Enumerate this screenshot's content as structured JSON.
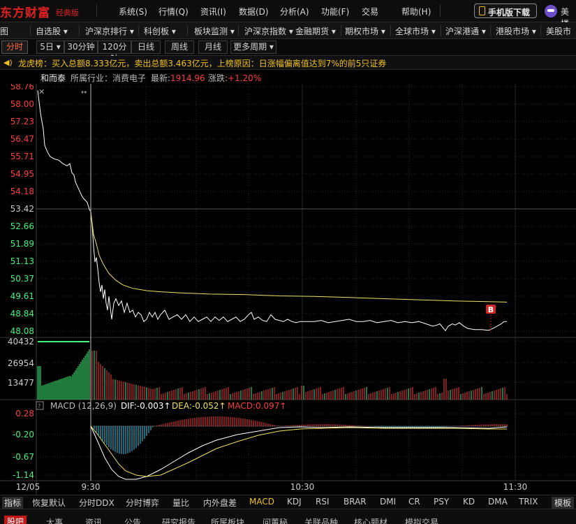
{
  "menubar": {
    "logo": "东方财富",
    "edition": "经典版",
    "items": [
      "系统(S)",
      "行情(Q)",
      "资讯(I)",
      "数据(D)",
      "分析(A)",
      "功能(F)",
      "交易",
      "帮助(H)"
    ],
    "mobile_button": "手机版下载",
    "user": "美楼"
  },
  "marketbar": {
    "items": [
      "自选股 ▾",
      "沪深京排行 ▾",
      "科创板 ▾",
      "板块监测 ▾",
      "沪深京指数 ▾",
      "金融期货 ▾",
      "期权市场 ▾",
      "全球市场 ▾",
      "沪深港通 ▾",
      "港股市场 ▾",
      "美股市场"
    ],
    "first_partial": "总图"
  },
  "periodbar": {
    "items": [
      "分时",
      "5日 ▾",
      "30分钟",
      "120分钟",
      "日线",
      "周线",
      "月线",
      "更多周期 ▾"
    ],
    "active": "分时"
  },
  "announce": {
    "text": "龙虎榜：买入总额8.333亿元，卖出总额3.463亿元，上榜原因：日涨幅偏离值达到7%的前5只证券"
  },
  "stock": {
    "name": "和而泰",
    "industry_label": "所属行业：",
    "industry": "消费电子",
    "latest_label": "最新:",
    "latest": "1914.96",
    "change_label": "涨跌:",
    "change": "+1.20%"
  },
  "price_axis": [
    "58.76",
    "58.00",
    "57.23",
    "56.47",
    "55.71",
    "54.95",
    "54.18",
    "53.42",
    "52.66",
    "51.89",
    "51.13",
    "50.37",
    "49.61",
    "48.84",
    "48.08"
  ],
  "volume_axis": [
    "40432",
    "26954",
    "13477"
  ],
  "macd": {
    "label": "MACD (12,26,9)",
    "dif": "DIF:-0.003↑",
    "dea": "DEA:-0.052↑",
    "macd": "MACD:0.097↑",
    "axis": [
      "0.28",
      "-0.20",
      "-0.67",
      "-1.14"
    ]
  },
  "time_axis": [
    "12/05",
    "9:30",
    "10:30",
    "11:30"
  ],
  "marker": "B",
  "indicators": {
    "label": "指标",
    "items": [
      "恢复默认",
      "分时DDX",
      "分时博弈",
      "量比",
      "内外盘差",
      "MACD",
      "KDJ",
      "RSI",
      "BRAR",
      "DMI",
      "CR",
      "PSY",
      "KD",
      "DMA",
      "TRIX"
    ],
    "active": "MACD",
    "template": "模板"
  },
  "bottom_tabs": {
    "items": [
      "股吧",
      "大事",
      "资讯",
      "公告",
      "研究报告",
      "所属板块",
      "问董秘",
      "关联品种",
      "核心题材",
      "模拟交易"
    ],
    "active": "股吧"
  },
  "colors": {
    "up": "#ff3b3b",
    "down": "#3ff57a",
    "price_line": "#ffffff",
    "avg_line": "#f0e060",
    "macd_dea": "#f0e060",
    "accent": "#f0c020"
  }
}
